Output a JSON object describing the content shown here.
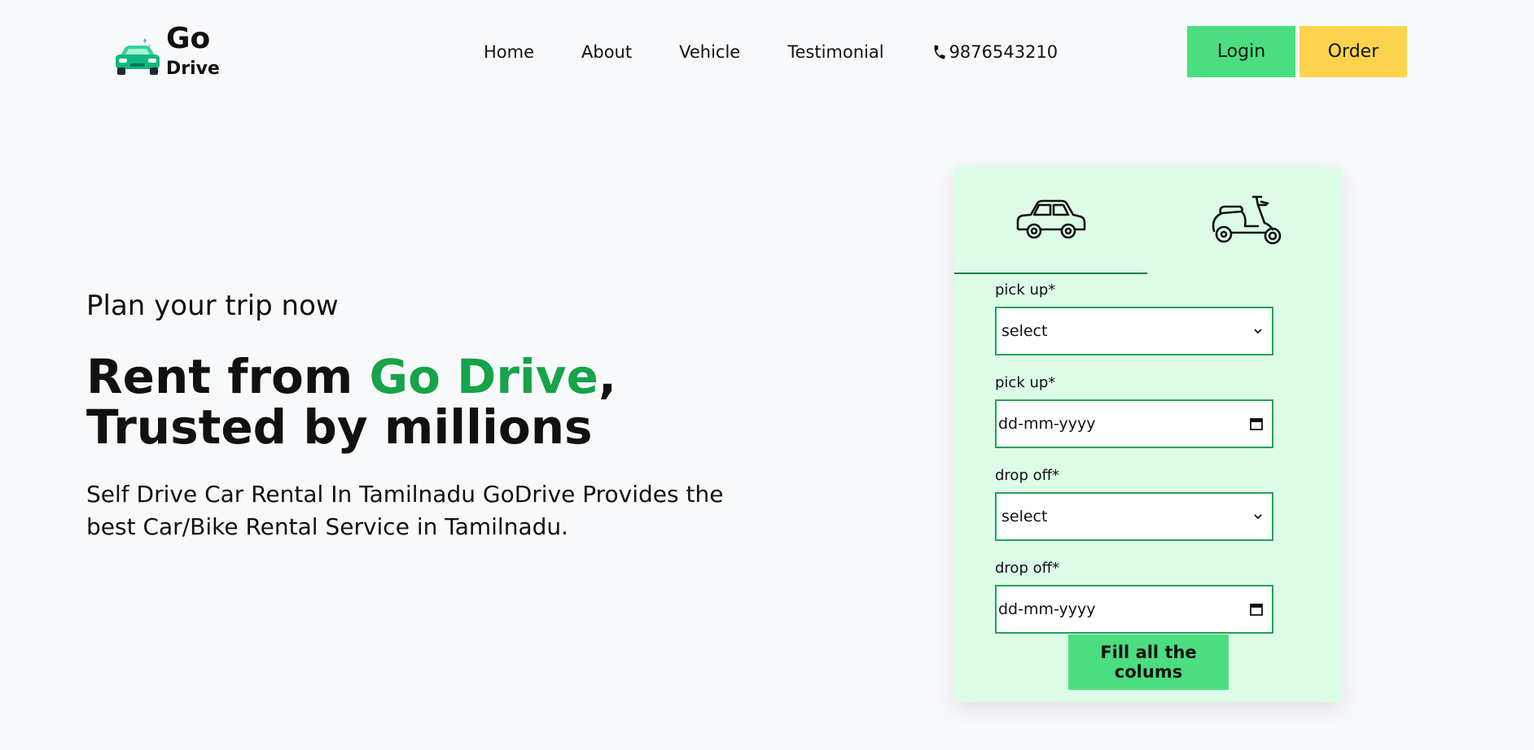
{
  "brand": {
    "name_top": "Go",
    "name_bottom": "Drive",
    "primary_color": "#16a34a",
    "accent_green": "#4ade80",
    "accent_yellow": "#fcd34d",
    "logo_icon": "car-icon"
  },
  "nav": {
    "items": [
      "Home",
      "About",
      "Vehicle",
      "Testimonial"
    ],
    "phone": "9876543210",
    "phone_icon": "phone-icon"
  },
  "header_buttons": {
    "login": "Login",
    "order": "Order"
  },
  "hero": {
    "subtitle": "Plan your trip now",
    "title_prefix": "Rent from ",
    "title_highlight": "Go Drive",
    "title_suffix": ", Trusted by millions",
    "description": "Self Drive Car Rental In Tamilnadu GoDrive Provides the best Car/Bike Rental Service in Tamilnadu."
  },
  "booking": {
    "tabs": [
      {
        "icon": "car-icon",
        "active": true
      },
      {
        "icon": "scooter-icon",
        "active": false
      }
    ],
    "fields": [
      {
        "label": "pick up*",
        "type": "select",
        "value": "select"
      },
      {
        "label": "pick up*",
        "type": "date",
        "value": "dd-mm-yyyy"
      },
      {
        "label": "drop off*",
        "type": "select",
        "value": "select"
      },
      {
        "label": "drop off*",
        "type": "date",
        "value": "dd-mm-yyyy"
      }
    ],
    "submit_label": "Fill all the colums"
  }
}
